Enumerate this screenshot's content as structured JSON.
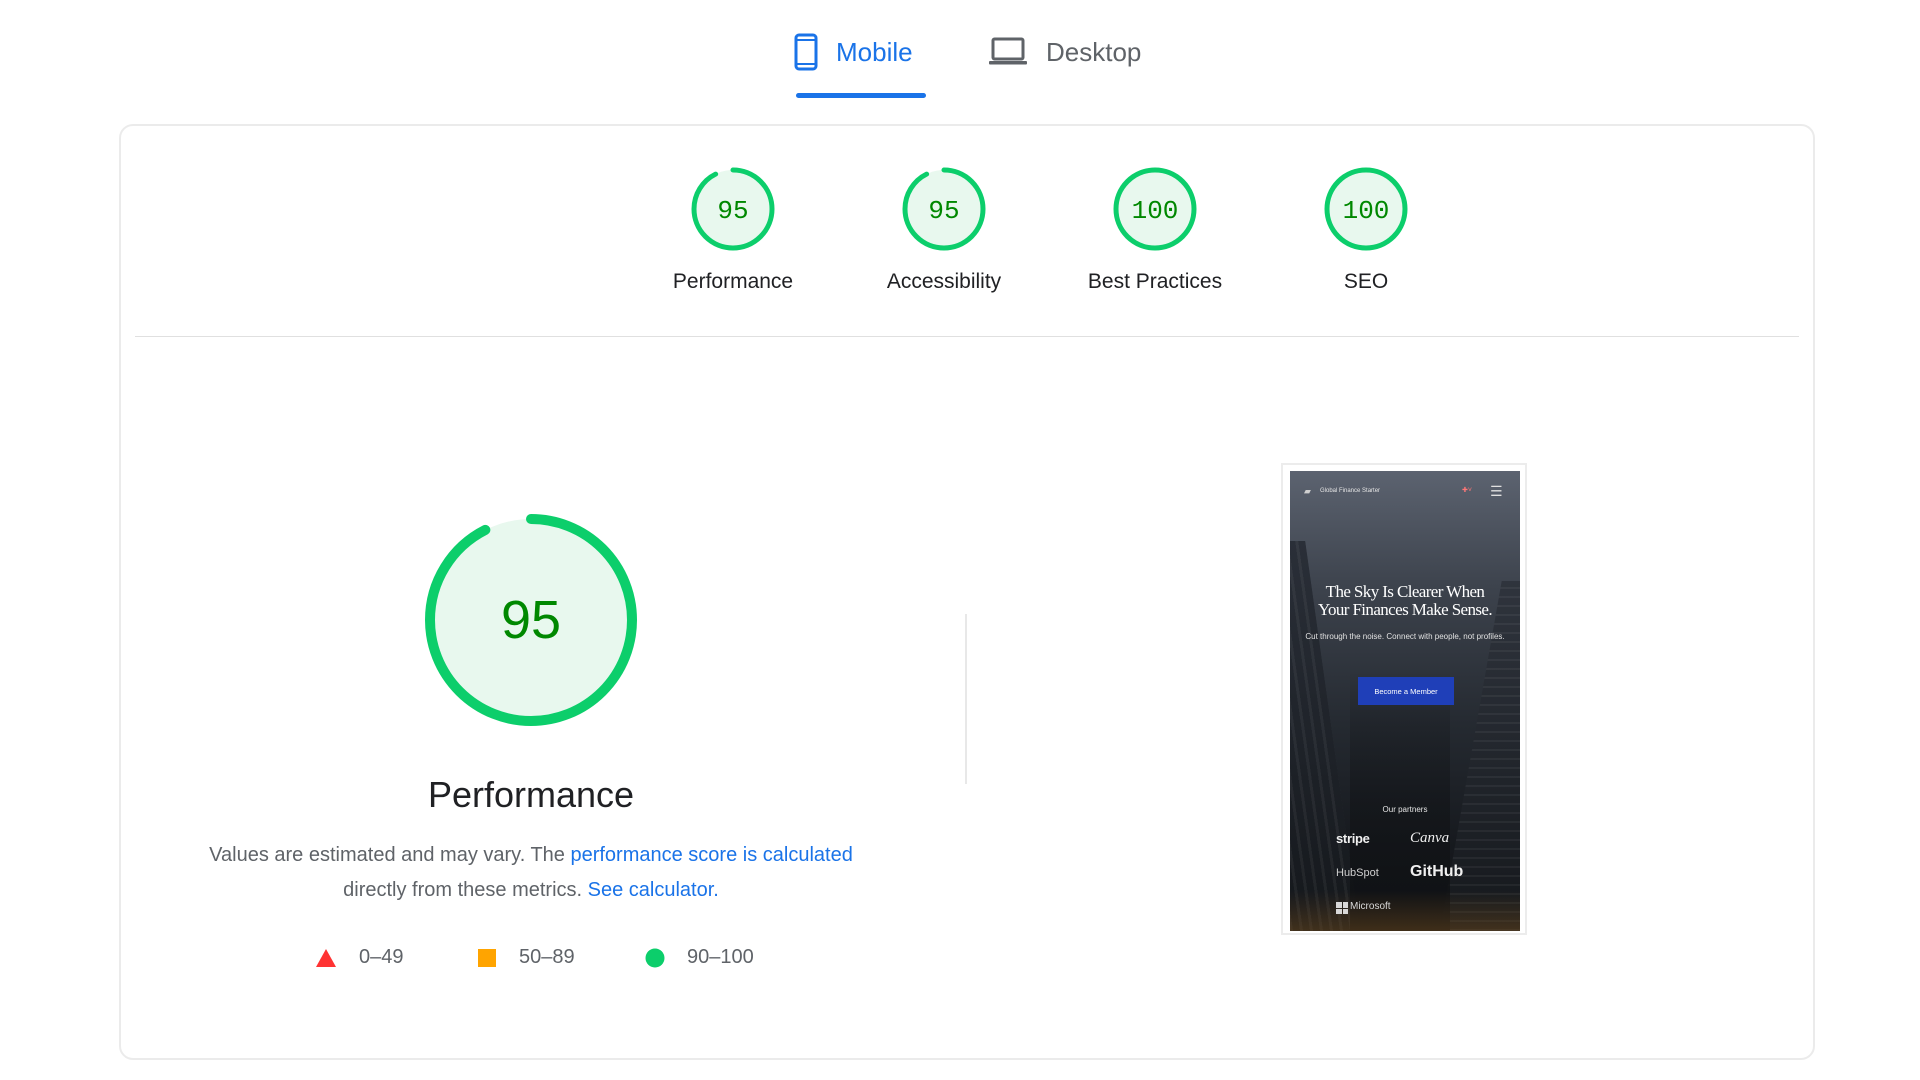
{
  "tabs": [
    {
      "label": "Mobile",
      "icon": "smartphone-icon",
      "active": true
    },
    {
      "label": "Desktop",
      "icon": "laptop-icon",
      "active": false
    }
  ],
  "colors": {
    "accent": "#1a73e8",
    "pass": "#0cce6b",
    "pass_text": "#008800",
    "average": "#ffa400",
    "fail": "#ff3333",
    "pass_fill": "#e8f8ee"
  },
  "gauges": [
    {
      "label": "Performance",
      "score": "95",
      "value": 95
    },
    {
      "label": "Accessibility",
      "score": "95",
      "value": 95
    },
    {
      "label": "Best Practices",
      "score": "100",
      "value": 100
    },
    {
      "label": "SEO",
      "score": "100",
      "value": 100
    }
  ],
  "performance": {
    "score": "95",
    "value": 95,
    "title": "Performance",
    "desc_prefix": "Values are estimated and may vary. The ",
    "link_score": "performance score is calculated",
    "desc_mid": " directly from these metrics. ",
    "link_calc": "See calculator.",
    "legend": [
      {
        "range": "0–49",
        "shape": "triangle",
        "color": "#ff3333"
      },
      {
        "range": "50–89",
        "shape": "square",
        "color": "#ffa400"
      },
      {
        "range": "90–100",
        "shape": "circle",
        "color": "#0cce6b"
      }
    ]
  },
  "screenshot": {
    "site_name": "Global Finance Starter",
    "flag_glyph": "✚˅",
    "menu_glyph": "☰",
    "headline_line1": "The Sky Is Clearer When",
    "headline_line2": "Your Finances Make Sense.",
    "subtext": "Cut through the noise. Connect with people, not profiles.",
    "cta": "Become a Member",
    "partners_label": "Our partners",
    "partners": [
      "stripe",
      "Canva",
      "HubSpot",
      "GitHub",
      "Microsoft"
    ]
  }
}
